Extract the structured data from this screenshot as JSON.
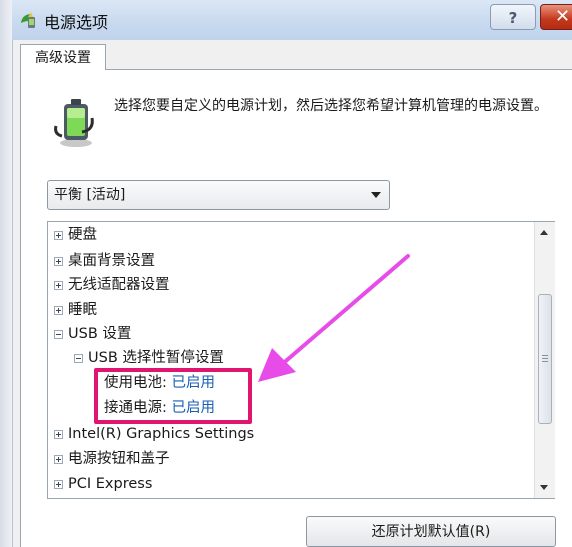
{
  "window": {
    "title": "电源选项",
    "help_label": "?",
    "close_label": "✕"
  },
  "tab": {
    "label": "高级设置"
  },
  "description": "选择您要自定义的电源计划，然后选择您希望计算机管理的电源设置。",
  "plan_select": {
    "value": "平衡 [活动]"
  },
  "tree": {
    "hard_disk": "硬盘",
    "desktop_background": "桌面背景设置",
    "wireless_adapter": "无线适配器设置",
    "sleep": "睡眠",
    "usb": "USB 设置",
    "usb_selective": "USB 选择性暂停设置",
    "on_battery_label": "使用电池:",
    "on_battery_value": "已启用",
    "plugged_in_label": "接通电源:",
    "plugged_in_value": "已启用",
    "intel_graphics": "Intel(R) Graphics Settings",
    "power_buttons_lid": "电源按钮和盖子",
    "pci_express": "PCI Express"
  },
  "buttons": {
    "restore_defaults": "还原计划默认值(R)"
  },
  "colors": {
    "highlight": "#e0156f",
    "link_value": "#1a5fb4",
    "annotation_arrow": "#e84ce8"
  }
}
